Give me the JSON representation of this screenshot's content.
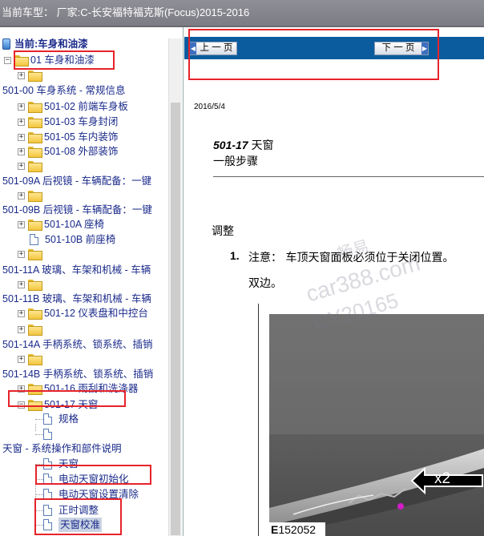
{
  "titlebar": {
    "text": "当前车型：  厂家:C-长安福特福克斯(Focus)2015-2016"
  },
  "tree": {
    "root_label": "当前:车身和油漆",
    "items": [
      {
        "kind": "folder",
        "label": "01 车身和油漆",
        "exp": "−"
      },
      {
        "kind": "folder",
        "label": "",
        "exp": "+"
      },
      {
        "kind": "text",
        "label": "501-00 车身系统 - 常规信息"
      },
      {
        "kind": "folder",
        "label": "501-02 前端车身板",
        "exp": "+"
      },
      {
        "kind": "folder",
        "label": "501-03 车身封闭",
        "exp": "+"
      },
      {
        "kind": "folder",
        "label": "501-05 车内装饰",
        "exp": "+"
      },
      {
        "kind": "folder",
        "label": "501-08 外部装饰",
        "exp": "+"
      },
      {
        "kind": "folder",
        "label": "",
        "exp": "+"
      },
      {
        "kind": "text",
        "label": "501-09A 后视镜 - 车辆配备：一键"
      },
      {
        "kind": "folder",
        "label": "",
        "exp": "+"
      },
      {
        "kind": "text",
        "label": "501-09B 后视镜 - 车辆配备：一键"
      },
      {
        "kind": "folder",
        "label": "501-10A 座椅",
        "exp": "+"
      },
      {
        "kind": "page",
        "label": "501-10B 前座椅"
      },
      {
        "kind": "folder",
        "label": "",
        "exp": "+"
      },
      {
        "kind": "text",
        "label": "501-11A 玻璃、车架和机械 - 车辆"
      },
      {
        "kind": "folder",
        "label": "",
        "exp": "+"
      },
      {
        "kind": "text",
        "label": "501-11B 玻璃、车架和机械 - 车辆"
      },
      {
        "kind": "folder",
        "label": "501-12 仪表盘和中控台",
        "exp": "+"
      },
      {
        "kind": "folder",
        "label": "",
        "exp": "+"
      },
      {
        "kind": "text",
        "label": "501-14A 手柄系统、锁系统、插销"
      },
      {
        "kind": "folder",
        "label": "",
        "exp": "+"
      },
      {
        "kind": "text",
        "label": "501-14B 手柄系统、锁系统、插销"
      },
      {
        "kind": "folder",
        "label": "501-16 雨刮和洗涤器",
        "exp": "+"
      },
      {
        "kind": "folder",
        "label": "501-17 天窗",
        "exp": "−"
      },
      {
        "kind": "page2",
        "label": "规格"
      },
      {
        "kind": "page2",
        "label": ""
      },
      {
        "kind": "text",
        "label": "天窗 - 系统操作和部件说明"
      },
      {
        "kind": "page2",
        "label": "天窗"
      },
      {
        "kind": "page2",
        "label": "电动天窗初始化"
      },
      {
        "kind": "page2",
        "label": "电动天窗设置清除"
      },
      {
        "kind": "page2",
        "label": "正时调整"
      },
      {
        "kind": "page2",
        "label": "天窗校准",
        "selected": true
      }
    ]
  },
  "nav": {
    "prev_label": "上 一 页",
    "next_label": "下 一 页"
  },
  "doc": {
    "date": "2016/5/4",
    "title_code": "501-17",
    "title_text": " 天窗",
    "subtitle": "一般步骤",
    "section": "调整",
    "step_number": "1.",
    "step_text": "注意：  车顶天窗面板必须位于关闭位置。",
    "step_text2": "双边。",
    "figure_label_prefix": "E",
    "figure_label_num": "152052",
    "callout": "x2"
  },
  "watermark": {
    "line1": "畅易",
    "line2": "car388.com",
    "line3": "CY20165"
  },
  "colors": {
    "navbar": "#0a5c9e",
    "titlebar": "#85858c",
    "highlight_box": "#e6232a",
    "selection": "#c9d3e3"
  }
}
